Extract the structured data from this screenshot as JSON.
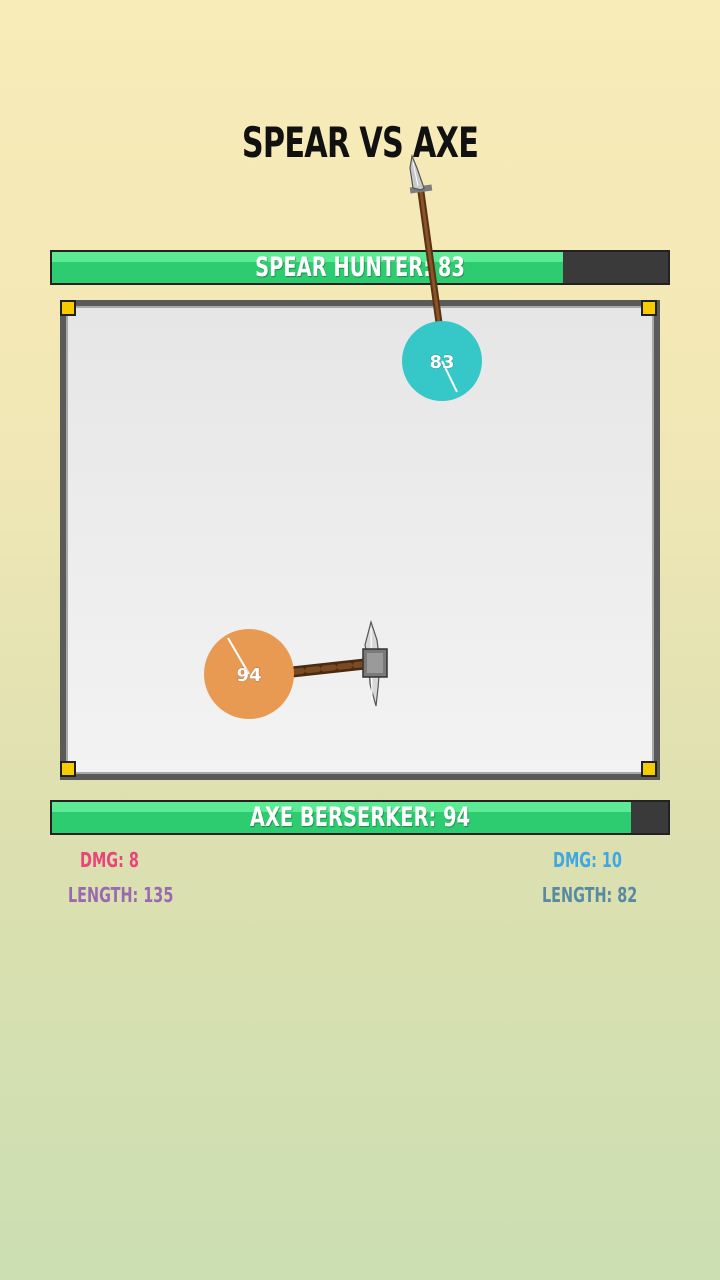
{
  "title": "SPEAR VS AXE",
  "top_bar": {
    "label": "SPEAR HUNTER: 83",
    "fill_fraction": 0.83
  },
  "bottom_bar": {
    "label": "AXE BERSERKER: 94",
    "fill_fraction": 0.94
  },
  "spear_ball": {
    "hp": "83",
    "color": "#36c8c8"
  },
  "axe_ball": {
    "hp": "94",
    "color": "#e89a52"
  },
  "stats_left": {
    "dmg": "DMG: 8",
    "length": "LENGTH: 135",
    "dmg_color": "#e8457a",
    "length_color": "#9a6ab0"
  },
  "stats_right": {
    "dmg": "DMG: 10",
    "length": "LENGTH: 82",
    "dmg_color": "#3fa8e0",
    "length_color": "#5a8aa0"
  },
  "colors": {
    "hp_fill": "#2ecc71",
    "hp_bg": "#3a3a3a",
    "corner": "#f5cc00"
  }
}
